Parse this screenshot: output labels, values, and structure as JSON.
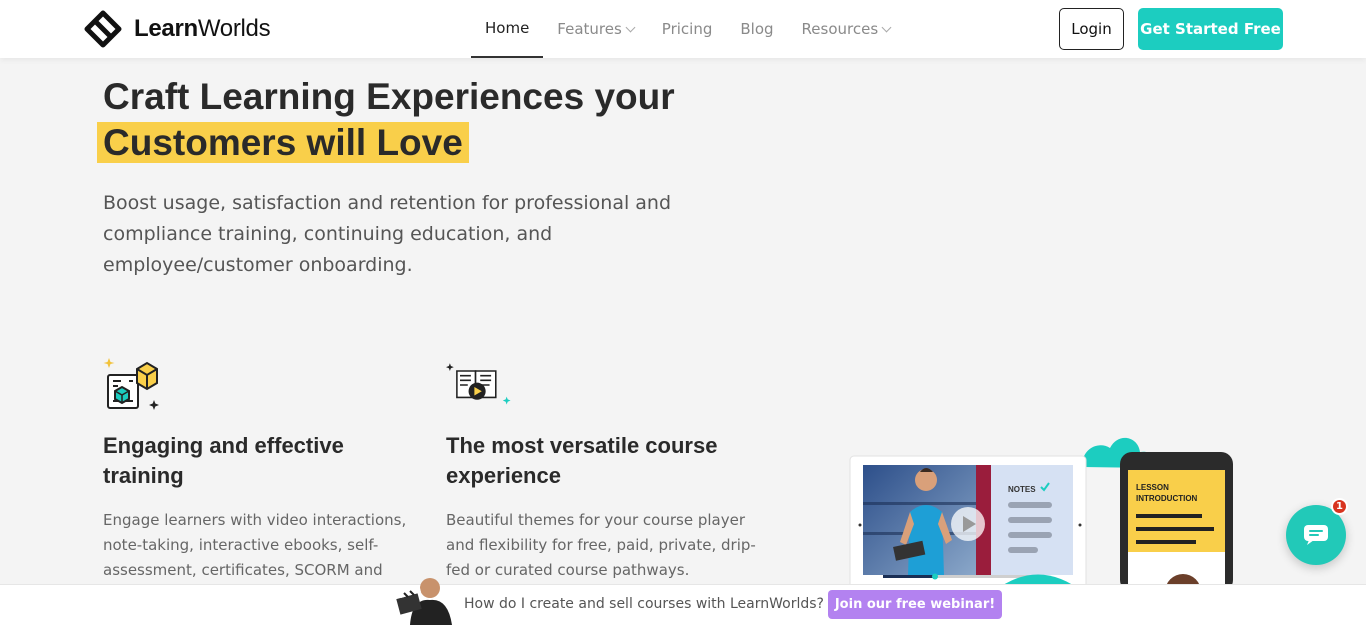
{
  "brand": {
    "logo_bold": "Learn",
    "logo_regular": "Worlds"
  },
  "nav": {
    "items": [
      {
        "label": "Home",
        "active": true,
        "dropdown": false
      },
      {
        "label": "Features",
        "active": false,
        "dropdown": true
      },
      {
        "label": "Pricing",
        "active": false,
        "dropdown": false
      },
      {
        "label": "Blog",
        "active": false,
        "dropdown": false
      },
      {
        "label": "Resources",
        "active": false,
        "dropdown": true
      }
    ],
    "login_label": "Login",
    "cta_label": "Get Started Free"
  },
  "hero": {
    "title_line1": "Craft Learning Experiences your",
    "title_highlight": "Customers will Love",
    "lead": "Boost usage, satisfaction and retention for professional and compliance training, continuing education, and employee/customer onboarding."
  },
  "features": [
    {
      "title_line1": "Engaging and effective",
      "title_line2": "training",
      "text": "Engage learners with video interactions, note-taking, interactive ebooks, self-assessment, certificates, SCORM and"
    },
    {
      "title_line1": "The most versatile course",
      "title_line2": "experience",
      "text": "Beautiful themes for your course player and flexibility for free, paid, private, drip-fed or curated course pathways."
    }
  ],
  "illustration": {
    "notes_label": "NOTES",
    "lesson_line1": "LESSON",
    "lesson_line2": "INTRODUCTION"
  },
  "chat": {
    "badge_count": "1"
  },
  "bottom_bar": {
    "question": "How do I create and sell courses with LearnWorlds?",
    "button_label": "Join our free webinar!"
  },
  "colors": {
    "accent": "#1ccdc0",
    "highlight": "#f9cf4a",
    "webinar": "#b382f0",
    "badge": "#d8341f"
  }
}
